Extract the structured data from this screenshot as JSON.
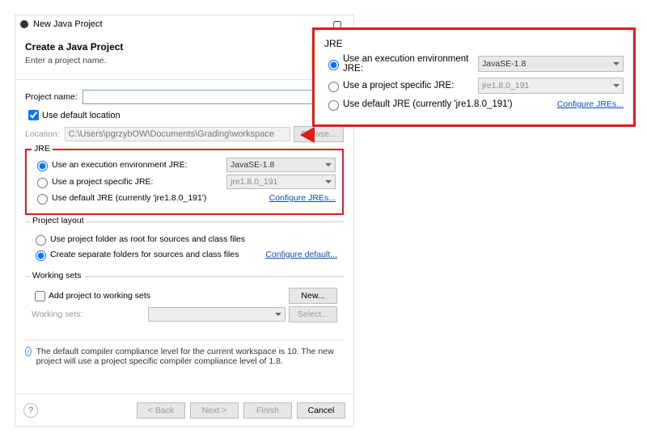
{
  "window": {
    "title": "New Java Project"
  },
  "header": {
    "title": "Create a Java Project",
    "subtitle": "Enter a project name."
  },
  "project_name": {
    "label": "Project name:",
    "value": ""
  },
  "use_default_location": {
    "label": "Use default location",
    "checked": true
  },
  "location": {
    "label": "Location:",
    "value": "C:\\Users\\pgrzybOW\\Documents\\Grading\\workspace",
    "browse": "Browse..."
  },
  "jre": {
    "legend": "JRE",
    "option_env": "Use an execution environment JRE:",
    "env_value": "JavaSE-1.8",
    "option_specific": "Use a project specific JRE:",
    "specific_value": "jre1.8.0_191",
    "option_default": "Use default JRE (currently 'jre1.8.0_191')",
    "configure": "Configure JREs..."
  },
  "layout": {
    "legend": "Project layout",
    "opt_root": "Use project folder as root for sources and class files",
    "opt_separate": "Create separate folders for sources and class files",
    "configure": "Configure default..."
  },
  "working_sets": {
    "legend": "Working sets",
    "add_label": "Add project to working sets",
    "new": "New...",
    "label": "Working sets:",
    "select": "Select..."
  },
  "info": "The default compiler compliance level for the current workspace is 10. The new project will use a project specific compiler compliance level of 1.8.",
  "buttons": {
    "back": "< Back",
    "next": "Next >",
    "finish": "Finish",
    "cancel": "Cancel"
  }
}
